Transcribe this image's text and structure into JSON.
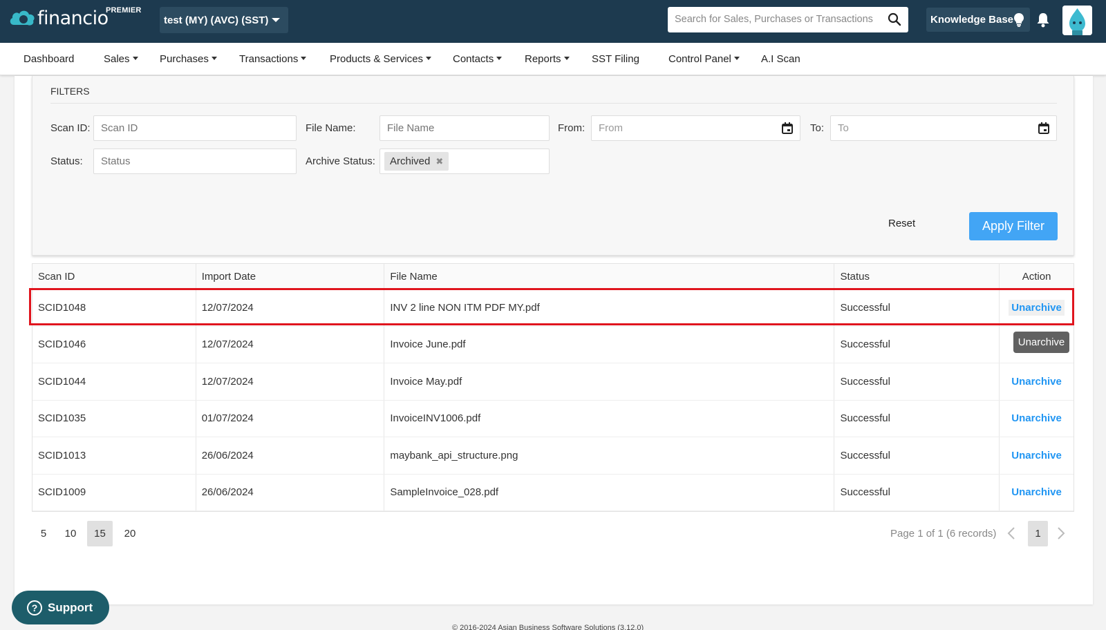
{
  "brand": {
    "logo_text": "financio",
    "tier": "PREMIER"
  },
  "company_select": {
    "label": "test (MY) (AVC) (SST)"
  },
  "search": {
    "placeholder": "Search for Sales, Purchases or Transactions"
  },
  "knowledge_base": {
    "label": "Knowledge Base"
  },
  "nav": {
    "items": [
      {
        "label": "Dashboard",
        "dropdown": false
      },
      {
        "label": "Sales",
        "dropdown": true
      },
      {
        "label": "Purchases",
        "dropdown": true
      },
      {
        "label": "Transactions",
        "dropdown": true
      },
      {
        "label": "Products & Services",
        "dropdown": true
      },
      {
        "label": "Contacts",
        "dropdown": true
      },
      {
        "label": "Reports",
        "dropdown": true
      },
      {
        "label": "SST Filing",
        "dropdown": false
      },
      {
        "label": "Control Panel",
        "dropdown": true
      },
      {
        "label": "A.I Scan",
        "dropdown": false
      }
    ]
  },
  "filters": {
    "title": "FILTERS",
    "scan_id": {
      "label": "Scan ID:",
      "placeholder": "Scan ID",
      "value": ""
    },
    "file_name": {
      "label": "File Name:",
      "placeholder": "File Name",
      "value": ""
    },
    "from": {
      "label": "From:",
      "placeholder": "From",
      "value": ""
    },
    "to": {
      "label": "To:",
      "placeholder": "To",
      "value": ""
    },
    "status": {
      "label": "Status:",
      "placeholder": "Status",
      "value": ""
    },
    "archive_status": {
      "label": "Archive Status:",
      "selected_tag": "Archived"
    },
    "reset_label": "Reset",
    "apply_label": "Apply Filter"
  },
  "table": {
    "headers": [
      "Scan ID",
      "Import Date",
      "File Name",
      "Status",
      "Action"
    ],
    "rows": [
      {
        "scan_id": "SCID1048",
        "import_date": "12/07/2024",
        "file_name": "INV 2 line NON ITM PDF MY.pdf",
        "status": "Successful",
        "action": "Unarchive"
      },
      {
        "scan_id": "SCID1046",
        "import_date": "12/07/2024",
        "file_name": "Invoice June.pdf",
        "status": "Successful",
        "action": "Unarchive"
      },
      {
        "scan_id": "SCID1044",
        "import_date": "12/07/2024",
        "file_name": "Invoice May.pdf",
        "status": "Successful",
        "action": "Unarchive"
      },
      {
        "scan_id": "SCID1035",
        "import_date": "01/07/2024",
        "file_name": "InvoiceINV1006.pdf",
        "status": "Successful",
        "action": "Unarchive"
      },
      {
        "scan_id": "SCID1013",
        "import_date": "26/06/2024",
        "file_name": "maybank_api_structure.png",
        "status": "Successful",
        "action": "Unarchive"
      },
      {
        "scan_id": "SCID1009",
        "import_date": "26/06/2024",
        "file_name": "SampleInvoice_028.pdf",
        "status": "Successful",
        "action": "Unarchive"
      }
    ],
    "tooltip": "Unarchive"
  },
  "pagination": {
    "page_sizes": [
      "5",
      "10",
      "15",
      "20"
    ],
    "selected_page_size": "15",
    "info": "Page 1 of 1 (6 records)",
    "current_page": "1"
  },
  "support": {
    "label": "Support"
  },
  "footer": {
    "text": "© 2016-2024 Asian Business Software Solutions (3.12.0)"
  },
  "colors": {
    "topbar": "#1d3a4f",
    "accent": "#42a5f5",
    "link": "#2196f3",
    "highlight": "#e0151e",
    "support": "#1d5d6a"
  }
}
